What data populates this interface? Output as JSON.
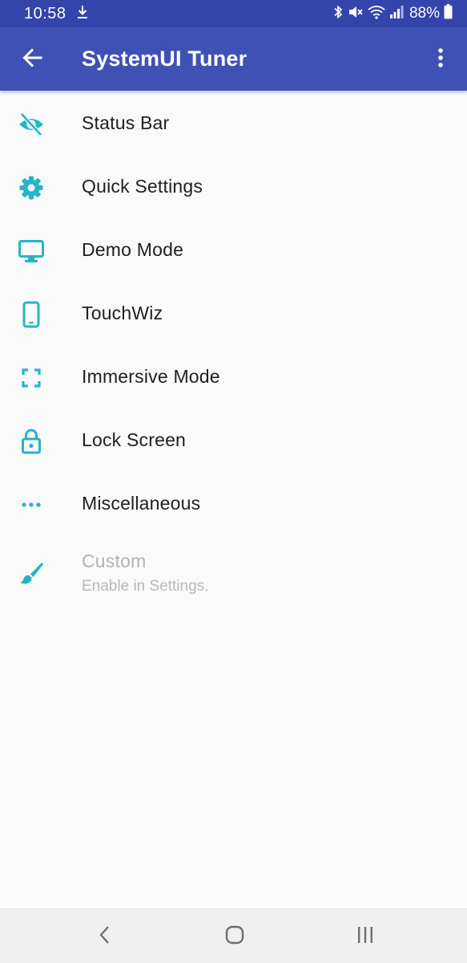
{
  "status_bar": {
    "time": "10:58",
    "battery_text": "88%",
    "icons": [
      "download-icon",
      "bluetooth-icon",
      "mute-icon",
      "wifi-icon",
      "signal-icon",
      "battery-icon"
    ]
  },
  "app_bar": {
    "title": "SystemUI Tuner",
    "back_icon": "arrow-back-icon",
    "menu_icon": "more-vert-icon"
  },
  "menu": {
    "items": [
      {
        "label": "Status Bar",
        "icon": "eye-off-icon"
      },
      {
        "label": "Quick Settings",
        "icon": "gear-icon"
      },
      {
        "label": "Demo Mode",
        "icon": "monitor-icon"
      },
      {
        "label": "TouchWiz",
        "icon": "phone-icon"
      },
      {
        "label": "Immersive Mode",
        "icon": "fullscreen-icon"
      },
      {
        "label": "Lock Screen",
        "icon": "lock-icon"
      },
      {
        "label": "Miscellaneous",
        "icon": "more-horiz-icon"
      },
      {
        "label": "Custom",
        "summary": "Enable in Settings.",
        "icon": "brush-icon",
        "enabled": false
      }
    ]
  },
  "nav_bar": {
    "icons": [
      "nav-back-icon",
      "nav-home-icon",
      "nav-recents-icon"
    ]
  },
  "colors": {
    "app_bar": "#3f51b5",
    "status_bar": "#3344aa",
    "accent": "#26b5c7",
    "text_primary": "#202020",
    "text_disabled": "#b3b3b3"
  }
}
